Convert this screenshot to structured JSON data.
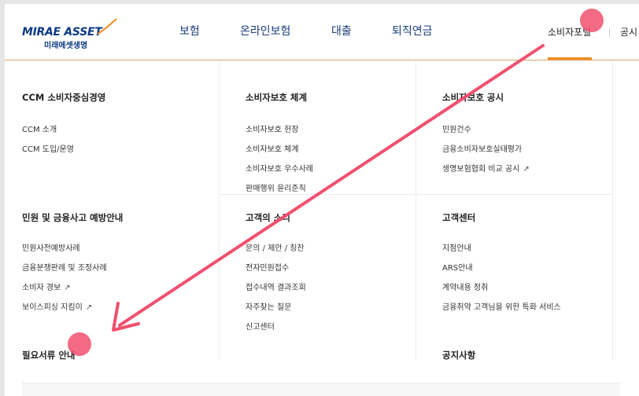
{
  "logo": {
    "main": "MIRAE ASSET",
    "sub": "미래에셋생명"
  },
  "gnb": {
    "items": [
      "보험",
      "온라인보험",
      "대출",
      "퇴직연금",
      "소비자포털",
      "공시"
    ]
  },
  "menu": {
    "sections": [
      {
        "title": "CCM 소비자중심경영",
        "links": [
          "CCM 소개",
          "CCM 도입/운영"
        ]
      },
      {
        "title": "소비자보호 체계",
        "links": [
          "소비자보호 헌장",
          "소비자보호 체계",
          "소비자보호 우수사례",
          "판매행위 윤리준칙"
        ]
      },
      {
        "title": "소비자보호 공시",
        "links": [
          "민원건수",
          "금융소비자보호실태평가",
          "생명보험협회 비교 공시"
        ]
      },
      {
        "title": "민원 및 금융사고 예방안내",
        "links": [
          "민원사전예방사례",
          "금융분쟁판례 및 조정사례",
          "소비자 경보",
          "보이스피싱 지킴이"
        ]
      },
      {
        "title": "고객의 소리",
        "links": [
          "문의 / 제안 / 칭찬",
          "전자민원접수",
          "접수내역 결과조회",
          "자주찾는 질문",
          "신고센터"
        ]
      },
      {
        "title": "고객센터",
        "links": [
          "지점안내",
          "ARS안내",
          "계약내용 정취",
          "금융취약 고객님을 위한 특화 서비스"
        ]
      },
      {
        "title": "필요서류 안내",
        "links": []
      },
      {
        "title": "공지사항",
        "links": []
      }
    ],
    "external_link_symbol": "↗"
  },
  "colors": {
    "brand": "#0b3a86",
    "accent": "#f08a1d",
    "annotation": "#f0506e"
  },
  "icons": [
    "external-link-icon",
    "logo-swoosh-icon"
  ]
}
